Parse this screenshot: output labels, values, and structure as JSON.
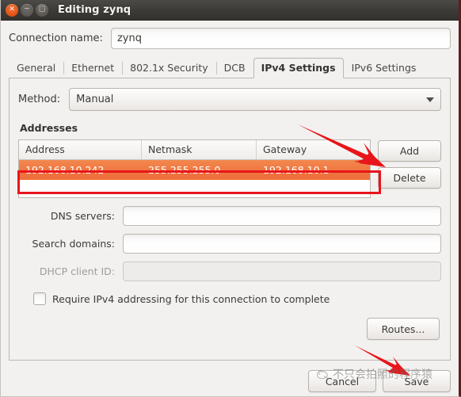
{
  "window": {
    "title": "Editing zynq",
    "controls": {
      "close": "×",
      "minimize": "−",
      "maximize": "□"
    }
  },
  "connection": {
    "label": "Connection name:",
    "value": "zynq"
  },
  "tabs": [
    {
      "label": "General",
      "active": false
    },
    {
      "label": "Ethernet",
      "active": false
    },
    {
      "label": "802.1x Security",
      "active": false
    },
    {
      "label": "DCB",
      "active": false
    },
    {
      "label": "IPv4 Settings",
      "active": true
    },
    {
      "label": "IPv6 Settings",
      "active": false
    }
  ],
  "method": {
    "label": "Method:",
    "value": "Manual"
  },
  "addresses": {
    "section_title": "Addresses",
    "columns": [
      "Address",
      "Netmask",
      "Gateway"
    ],
    "rows": [
      {
        "address": "192.168.10.242",
        "netmask": "255.255.255.0",
        "gateway": "192.168.10.1",
        "selected": true
      }
    ],
    "add_label": "Add",
    "delete_label": "Delete"
  },
  "fields": {
    "dns_label": "DNS servers:",
    "dns_value": "",
    "search_label": "Search domains:",
    "search_value": "",
    "dhcp_label": "DHCP client ID:",
    "dhcp_value": ""
  },
  "require_ipv4": {
    "label": "Require IPv4 addressing for this connection to complete",
    "checked": false
  },
  "routes": {
    "label": "Routes..."
  },
  "footer": {
    "cancel_label": "Cancel",
    "save_label": "Save"
  },
  "watermark": {
    "text": "不只会拍照的程序猿"
  },
  "annotations": {
    "highlight_color": "#e8151a",
    "selected_row_color": "#ef7540",
    "arrow_color": "#e8151a",
    "arrow_add_target": "Add",
    "arrow_save_target": "Save"
  }
}
